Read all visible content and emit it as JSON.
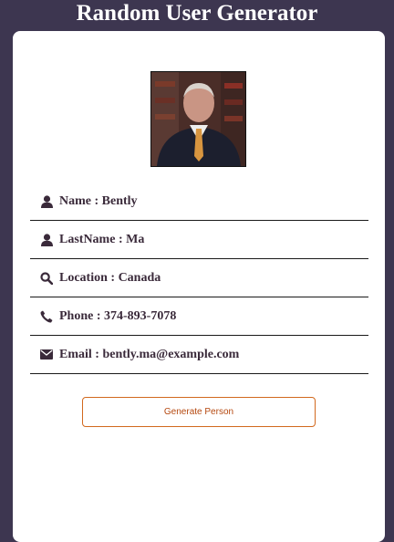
{
  "app": {
    "title": "Random User Generator"
  },
  "user": {
    "name_label": "Name",
    "name_value": "Bently",
    "lastname_label": "LastName",
    "lastname_value": "Ma",
    "location_label": "Location",
    "location_value": "Canada",
    "phone_label": "Phone",
    "phone_value": "374-893-7078",
    "email_label": "Email",
    "email_value": "bently.ma@example.com"
  },
  "actions": {
    "generate_label": "Generate Person"
  },
  "icons": {
    "name": "user-icon",
    "lastname": "user-icon",
    "location": "search-icon",
    "phone": "phone-icon",
    "email": "envelope-icon"
  },
  "colors": {
    "background": "#3d3650",
    "card": "#ffffff",
    "text": "#3a2a3a",
    "button_border": "#d2691e",
    "button_text": "#b5480f"
  }
}
